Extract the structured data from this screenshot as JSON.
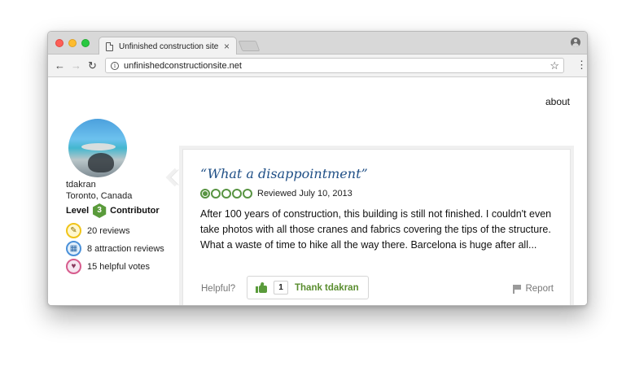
{
  "browser": {
    "tab_title": "Unfinished construction site",
    "tab_close": "×",
    "url": "unfinishedconstructionsite.net"
  },
  "page": {
    "about_link": "about"
  },
  "reviewer": {
    "username": "tdakran",
    "location": "Toronto, Canada",
    "level_label": "Level",
    "level_number": "3",
    "level_title": "Contributor",
    "stats": {
      "reviews": "20 reviews",
      "attraction_reviews": "8 attraction reviews",
      "helpful_votes": "15 helpful votes"
    }
  },
  "review": {
    "title": "“What a disappointment”",
    "rating": 1,
    "rating_max": 5,
    "rating_color": "#589442",
    "date": "Reviewed July 10, 2013",
    "body": "After 100 years of construction, this building is still not finished. I couldn't even take photos with all those cranes and fabrics covering the tips of the structure. What a waste of time to hike all the way there. Barcelona is huge after all...",
    "helpful_label": "Helpful?",
    "thank_count": "1",
    "thank_label": "Thank tdakran",
    "report_label": "Report"
  }
}
